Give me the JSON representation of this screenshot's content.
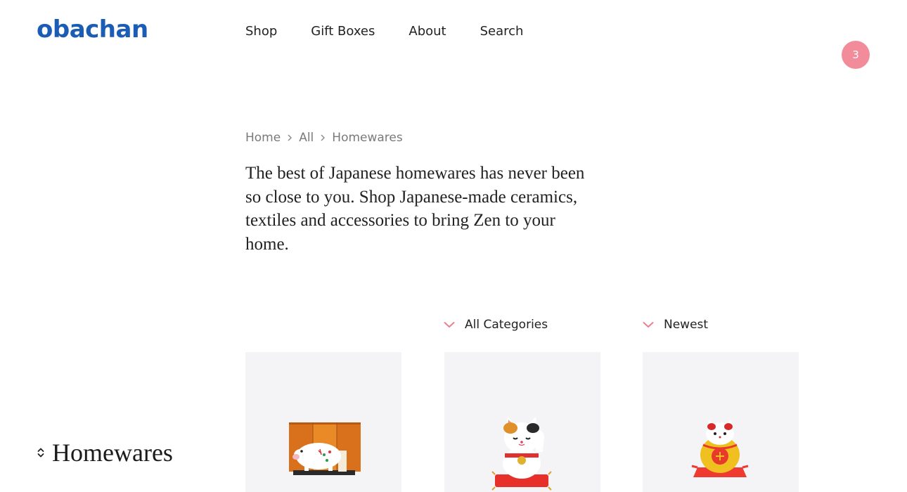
{
  "header": {
    "logo": "obachan",
    "nav": [
      {
        "label": "Shop"
      },
      {
        "label": "Gift Boxes"
      },
      {
        "label": "About"
      },
      {
        "label": "Search"
      }
    ],
    "cart_count": "3"
  },
  "breadcrumb": [
    "Home",
    "All",
    "Homewares"
  ],
  "intro": "The best of Japanese homewares has never been so close to you. Shop Japanese-made  ceramics, textiles and accessories  to bring Zen to your home.",
  "filters": {
    "category": "All Categories",
    "sort": "Newest"
  },
  "sidebar": {
    "title": "Homewares"
  },
  "products": [
    {
      "image": "boar-figurine-with-gold-screen"
    },
    {
      "image": "calico-maneki-neko-on-red-cushion"
    },
    {
      "image": "yellow-daruma-cat-on-red-cushion"
    }
  ],
  "colors": {
    "brand": "#1b5cb5",
    "badge": "#f28c9b",
    "chevron": "#e8818f",
    "card_bg": "#f4f4f6"
  }
}
